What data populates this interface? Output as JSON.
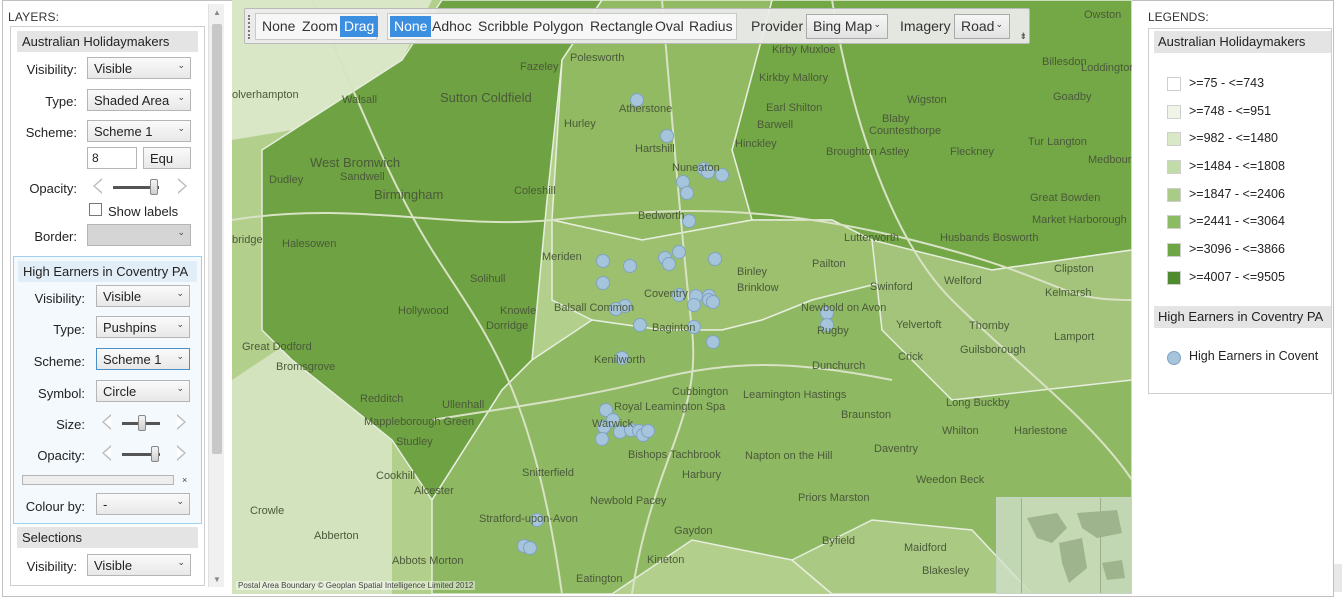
{
  "left_panel": {
    "title": "LAYERS:",
    "layers": [
      {
        "name": "Australian Holidaymakers",
        "visibility_label": "Visibility:",
        "visibility": "Visible",
        "type_label": "Type:",
        "type": "Shaded Area",
        "scheme_label": "Scheme:",
        "scheme": "Scheme 1",
        "class_count": "8",
        "class_method": "Equ",
        "opacity_label": "Opacity:",
        "opacity": 0.8,
        "show_labels": "Show labels",
        "border_label": "Border:"
      },
      {
        "name": "High Earners in Coventry PA",
        "visibility_label": "Visibility:",
        "visibility": "Visible",
        "type_label": "Type:",
        "type": "Pushpins",
        "scheme_label": "Scheme:",
        "scheme": "Scheme 1",
        "symbol_label": "Symbol:",
        "symbol": "Circle",
        "size_label": "Size:",
        "size": 0.4,
        "opacity_label": "Opacity:",
        "opacity": 0.8,
        "close_mark": "×",
        "colour_by_label": "Colour by:",
        "colour_by": "-"
      },
      {
        "name": "Selections",
        "visibility_label": "Visibility:",
        "visibility": "Visible"
      }
    ]
  },
  "toolbar": {
    "nav_modes": [
      "None",
      "Zoom",
      "Drag"
    ],
    "active_nav": "Drag",
    "select_modes": [
      "None",
      "Adhoc",
      "Scribble",
      "Polygon",
      "Rectangle",
      "Oval",
      "Radius"
    ],
    "active_select": "None",
    "provider_label": "Provider",
    "provider": "Bing Map",
    "imagery_label": "Imagery",
    "imagery": "Road",
    "expand_glyph": "⇟"
  },
  "map": {
    "copyright": "Postal Area Boundary © Geoplan Spatial Intelligence Limited 2012",
    "places": [
      "Owston",
      "Polesworth",
      "Kirby Muxloe",
      "Billesdon",
      "Loddington",
      "Fazeley",
      "Kirkby Mallory",
      "Wigston",
      "Goadby",
      "Sutton Coldfield",
      "Walsall",
      "olverhampton",
      "Atherstone",
      "Earl Shilton",
      "Blaby",
      "Countesthorpe",
      "Hurley",
      "Barwell",
      "Hartshill",
      "Hinckley",
      "Broughton Astley",
      "Fleckney",
      "Tur Langton",
      "Medbourne",
      "West Bromwich",
      "Sandwell",
      "Nuneaton",
      "Dudley",
      "Birmingham",
      "Coleshill",
      "Bedworth",
      "Great Bowden",
      "Market Harborough",
      "bridge",
      "Halesowen",
      "Meriden",
      "Lutterworth",
      "Husbands Bosworth",
      "Solihull",
      "Balsall Common",
      "Coventry",
      "Binley",
      "Brinklow",
      "Pailton",
      "Clipston",
      "Welford",
      "Kelmarsh",
      "Hollywood",
      "Knowle",
      "Dorridge",
      "Swinford",
      "Newbold on Avon",
      "Rugby",
      "Yelvertoft",
      "Thornby",
      "Guilsborough",
      "Lamport",
      "Great Dodford",
      "Kenilworth",
      "Baginton",
      "Dunchurch",
      "Crick",
      "Bromsgrove",
      "Redditch",
      "Ullenhall",
      "Cubbington",
      "Royal Leamington Spa",
      "Leamington Hastings",
      "Braunston",
      "Long Buckby",
      "Whilton",
      "Harlestone",
      "Mappleborough Green",
      "Studley",
      "Napton on the Hill",
      "Daventry",
      "Bishops Tachbrook",
      "Harbury",
      "Weedon Beck",
      "Cookhill",
      "Snitterfield",
      "Alcester",
      "Priors Marston",
      "Crowle",
      "Newbold Pacey",
      "Abberton",
      "Stratford-upon-Avon",
      "Gaydon",
      "Byfield",
      "Maidford",
      "Abbots Morton",
      "Kineton",
      "Eatington",
      "Blakesley",
      "Warwick"
    ]
  },
  "legend": {
    "title": "LEGENDS:",
    "layers": [
      {
        "name": "Australian Holidaymakers",
        "classes": [
          {
            "label": ">=75 - <=743",
            "color": "#ffffff"
          },
          {
            "label": ">=748 - <=951",
            "color": "#eef5e6"
          },
          {
            "label": ">=982 - <=1480",
            "color": "#d9e9c8"
          },
          {
            "label": ">=1484 - <=1808",
            "color": "#c2dca8"
          },
          {
            "label": ">=1847 - <=2406",
            "color": "#a8cc86"
          },
          {
            "label": ">=2441 - <=3064",
            "color": "#8bbb63"
          },
          {
            "label": ">=3096 - <=3866",
            "color": "#6ea545"
          },
          {
            "label": ">=4007 - <=9505",
            "color": "#4f8a2e"
          }
        ]
      },
      {
        "name": "High Earners in Coventry PA",
        "items": [
          {
            "label": "High Earners in Covent"
          }
        ]
      }
    ]
  },
  "colors": {
    "accent": "#3c8ee0",
    "pushpin": "#a6c4dc",
    "selected_layer_border": "#9fd0ee"
  }
}
